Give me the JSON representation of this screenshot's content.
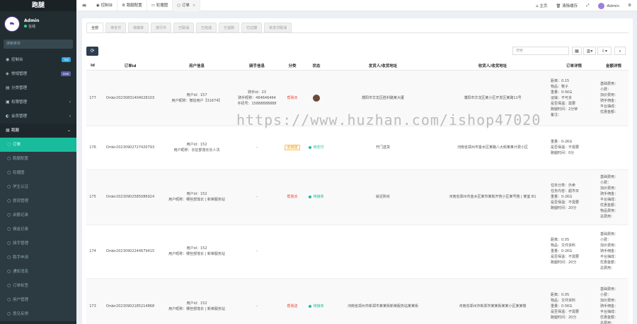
{
  "sidebar": {
    "logo": "跑腿",
    "user": {
      "name": "Admin",
      "status": "在线"
    },
    "search_placeholder": "搜索菜单",
    "items": [
      {
        "icon": "dashboard-icon",
        "label": "控制台",
        "badge": "hot",
        "badge_color": "#2ca5e0"
      },
      {
        "icon": "shield-icon",
        "label": "常规管理",
        "badge": "new",
        "badge_color": "#605ca8"
      },
      {
        "icon": "category-icon",
        "label": "分类管理"
      },
      {
        "icon": "lock-icon",
        "label": "权限管理",
        "arrow": "‹"
      },
      {
        "icon": "users-icon",
        "label": "会员管理",
        "arrow": "‹"
      },
      {
        "icon": "list-icon",
        "label": "跑腿",
        "arrow": "⌄"
      }
    ],
    "subitems": [
      {
        "label": "订单",
        "active": true
      },
      {
        "label": "跑腿配置"
      },
      {
        "label": "轮播图"
      },
      {
        "label": "学生认证"
      },
      {
        "label": "提现管理"
      },
      {
        "label": "余额记录"
      },
      {
        "label": "佣金记录"
      },
      {
        "label": "骑手管理"
      },
      {
        "label": "跑手申请"
      },
      {
        "label": "通知消息"
      },
      {
        "label": "订单标签"
      },
      {
        "label": "用户管理"
      },
      {
        "label": "意见反馈"
      }
    ]
  },
  "topbar": {
    "tabs": [
      {
        "label": "控制台",
        "icon": "dashboard-icon"
      },
      {
        "label": "跑腿配置",
        "icon": "cog-icon"
      },
      {
        "label": "轮播图",
        "icon": "image-icon"
      },
      {
        "label": "订单",
        "icon": "circle-icon",
        "active": true
      }
    ],
    "right": {
      "home": "主页",
      "clear_cache": "清除缓存",
      "user": "Admin"
    }
  },
  "status_tabs": [
    "全部",
    "待支付",
    "待接单",
    "进行中",
    "已取消",
    "已完成",
    "已退款",
    "已过期",
    "未支付取消"
  ],
  "search_placeholder": "搜索",
  "table": {
    "columns": [
      "Id",
      "订单id",
      "用户信息",
      "骑手信息",
      "分类",
      "状态",
      "发货人/收货地址",
      "收货人/收货地址",
      "订单详情",
      "金额详情"
    ],
    "rows": [
      {
        "id": "177",
        "order": "Order20230831404028103",
        "user": [
          "用户id：157",
          "用户昵称：微信用户【31674】"
        ],
        "rider": [
          "骑手id：23",
          "骑手昵称：464646464",
          "手机号：15888888888"
        ],
        "category": "帮我买",
        "status": "",
        "from": "濮阳市华龙区胜利路某大厦",
        "to": "濮阳市华龙区某小区开发区某路11号",
        "detail": [
          "距离：0.15",
          "物品：鞋子",
          "重量：0-5KG",
          "运输：不可多",
          "是否保温：需要",
          "跑腿时间：2分钟",
          "",
          "备注："
        ],
        "amount": [
          "基础费用：",
          "小费：",
          "加价费用：",
          "骑手佣金：",
          "平台抽成：",
          "优惠金额："
        ]
      },
      {
        "id": "176",
        "order": "Order20230902727420793",
        "user": [
          "用户id：152",
          "用户昵称：长征部落长长人法"
        ],
        "rider": [
          "-"
        ],
        "category": "全城送",
        "status": "待支付",
        "status_color": "green",
        "from": "开门送货",
        "to": "河南省郑州市金水区某路八大街某某计费小区",
        "detail": [
          "重量：0-2KG",
          "是否保温：不需要",
          "跑腿时间：0分"
        ],
        "amount": []
      },
      {
        "id": "175",
        "order": "Order20230902585086924",
        "user": [
          "用户id：152",
          "用户昵称：哪些部落长 | 新荣服务站"
        ],
        "rider": [
          "-"
        ],
        "category": "帮我买",
        "status": "待接单",
        "status_color": "green",
        "from": "就近购买",
        "to": "河南省郑州市金水区某市某街开荒小区某号楼 | 某室 B1",
        "detail": [
          "任务分类：外卖",
          "任务内容：超市买",
          "重量：0-2KG",
          "是否保温：不需要",
          "跑腿时间：20分"
        ],
        "amount": [
          "基础费用：",
          "小费：",
          "加价费用：",
          "骑手佣金：",
          "平台抽成：",
          "优惠金额：",
          "物品费用：",
          "总费用："
        ]
      },
      {
        "id": "174",
        "order": "Order20230902244679415",
        "user": [
          "用户id：152",
          "用户昵称：哪些部落长 | 新荣服务站"
        ],
        "rider": [
          "-"
        ],
        "category": "",
        "status": "",
        "from": "",
        "to": "",
        "detail": [
          "距离：0.05",
          "物品：文件资料",
          "重量：0-2KG",
          "是否保温：不需要",
          "跑腿时间：20分"
        ],
        "amount": [
          "基础费用：",
          "小费：",
          "加价费用：",
          "骑手佣金：",
          "平台抽成：",
          "优惠金额：",
          "总费用："
        ]
      },
      {
        "id": "173",
        "order": "Order20230902185214868",
        "user": [
          "用户id：152",
          "用户昵称：哪些部落长 | 新荣服务站"
        ],
        "rider": [
          "-"
        ],
        "category": "帮我送",
        "status": "待接单",
        "status_color": "green",
        "from": "河南省郑州市新郑市某某街新荣服务站某某街",
        "to": "河南省郑州市新郑市某某街某某小区某某楼",
        "detail": [
          "距离：0.05",
          "物品：文件资料",
          "重量：0-5KG",
          "是否保温：不需要",
          "跑腿时间：20分"
        ],
        "amount": [
          "基础费用：",
          "小费：",
          "加价费用：",
          "骑手佣金：",
          "平台抽成：",
          "优惠金额：",
          "总费用："
        ]
      }
    ]
  },
  "watermark": "https://www.huzhan.com/ishop47020"
}
